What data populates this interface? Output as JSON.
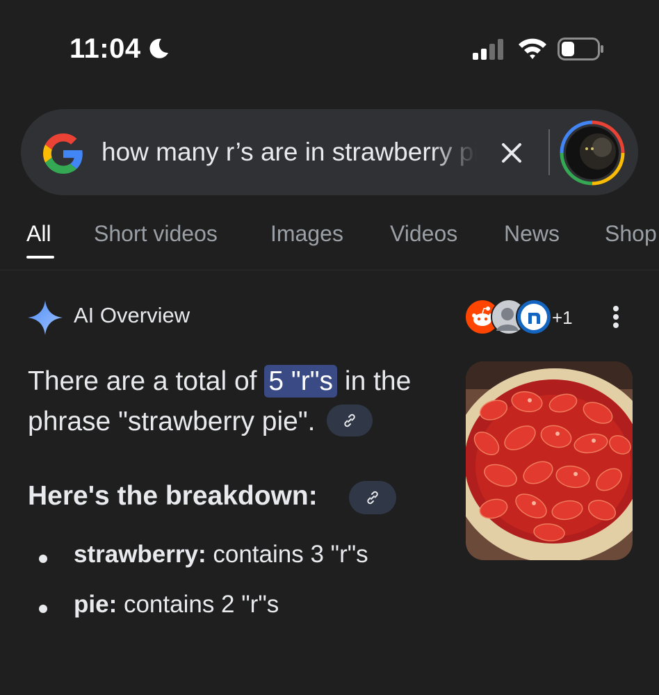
{
  "status_bar": {
    "time": "11:04",
    "icons": [
      "moon-icon",
      "signal-icon",
      "wifi-icon",
      "battery-icon"
    ]
  },
  "search": {
    "query": "how many r’s are in strawberry pie",
    "icons": [
      "google-logo-icon",
      "clear-icon",
      "lens-avatar-icon"
    ]
  },
  "tabs": [
    {
      "label": "All",
      "active": true
    },
    {
      "label": "Short videos"
    },
    {
      "label": "Images"
    },
    {
      "label": "Videos"
    },
    {
      "label": "News"
    },
    {
      "label": "Shop"
    }
  ],
  "ai_overview": {
    "title": "AI Overview",
    "sources_more": "+1",
    "answer_prefix": "There are a total of ",
    "answer_highlight": "5 \"r\"s",
    "answer_suffix": " in the phrase \"strawberry pie\".",
    "breakdown_title": "Here's the breakdown:",
    "bullets": [
      {
        "term": "strawberry:",
        "detail": " contains 3 \"r\"s"
      },
      {
        "term": "pie:",
        "detail": " contains 2 \"r\"s"
      }
    ]
  },
  "colors": {
    "background": "#1f1f1f",
    "pill": "#303134",
    "highlight": "#394a84",
    "sparkle": "#6a9cf8"
  }
}
